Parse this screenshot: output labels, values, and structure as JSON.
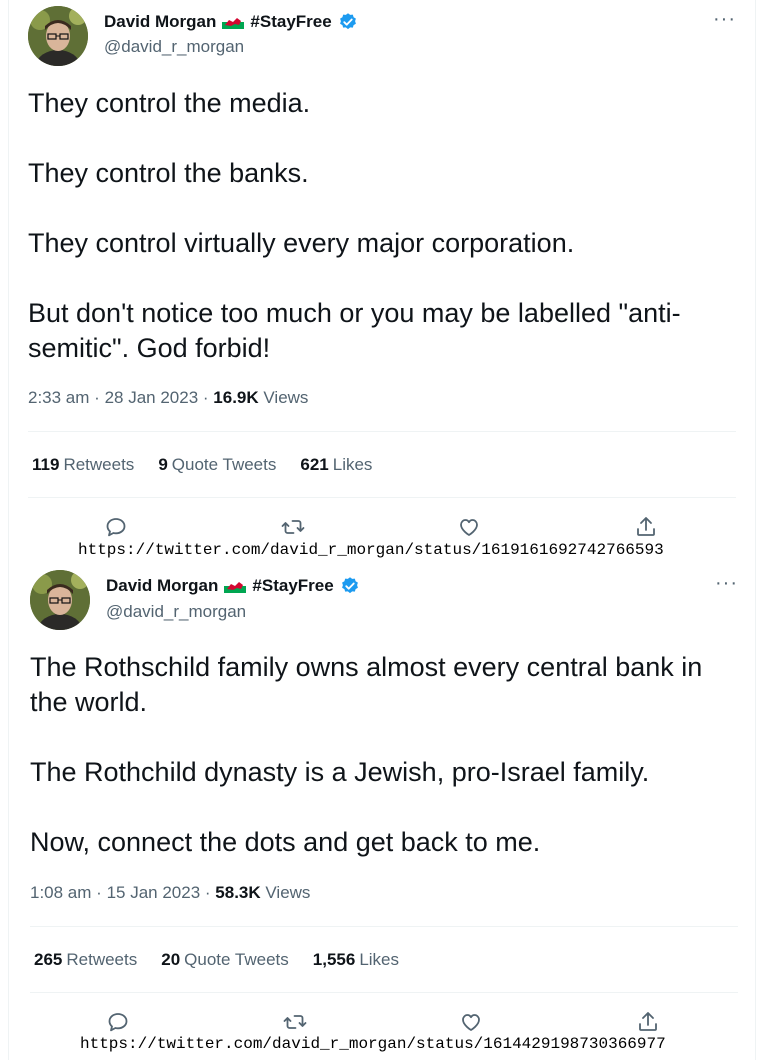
{
  "tweets": [
    {
      "name": "David Morgan",
      "hashtag": "#StayFree",
      "handle": "@david_r_morgan",
      "body": [
        "They control the media.",
        "They control the banks.",
        "They control virtually every major corporation.",
        "But don't notice too much or you may be labelled \"anti-semitic\". God forbid!"
      ],
      "time": "2:33 am",
      "date": "28 Jan 2023",
      "views_count": "16.9K",
      "views_label": "Views",
      "retweets_count": "119",
      "retweets_label": "Retweets",
      "quotes_count": "9",
      "quotes_label": "Quote Tweets",
      "likes_count": "621",
      "likes_label": "Likes",
      "url": "https://twitter.com/david_r_morgan/status/1619161692742766593"
    },
    {
      "name": "David Morgan",
      "hashtag": "#StayFree",
      "handle": "@david_r_morgan",
      "body": [
        "The Rothschild family owns almost every central bank in the world.",
        "The Rothchild dynasty is a Jewish, pro-Israel family.",
        "Now, connect the dots and get back to me."
      ],
      "time": "1:08 am",
      "date": "15 Jan 2023",
      "views_count": "58.3K",
      "views_label": "Views",
      "retweets_count": "265",
      "retweets_label": "Retweets",
      "quotes_count": "20",
      "quotes_label": "Quote Tweets",
      "likes_count": "1,556",
      "likes_label": "Likes",
      "url": "https://twitter.com/david_r_morgan/status/1614429198730366977"
    }
  ],
  "icons": {
    "more": "more-icon",
    "reply": "reply-icon",
    "retweet": "retweet-icon",
    "like": "heart-icon",
    "share": "share-icon",
    "verified": "verified-badge-icon",
    "flag": "wales-flag-icon"
  },
  "colors": {
    "verified": "#1d9bf0",
    "secondary_text": "#536471",
    "primary_text": "#0f1419",
    "divider": "#eff3f4"
  }
}
